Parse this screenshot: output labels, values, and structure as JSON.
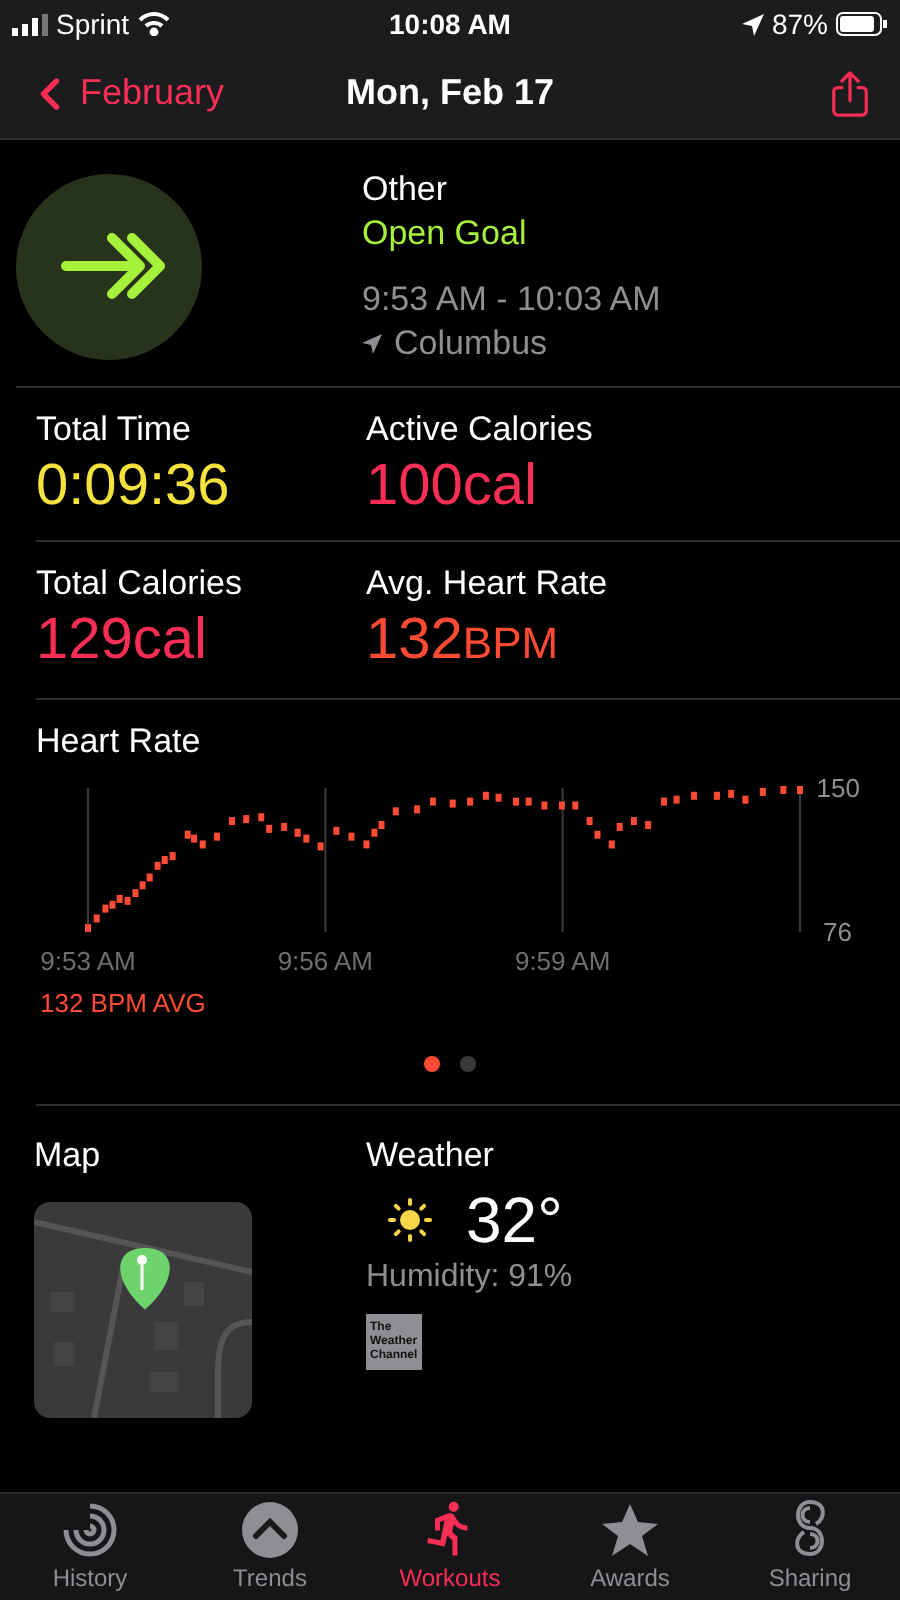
{
  "status_bar": {
    "carrier": "Sprint",
    "time": "10:08 AM",
    "battery": "87%"
  },
  "nav": {
    "back": "February",
    "title": "Mon, Feb 17"
  },
  "workout": {
    "type": "Other",
    "goal": "Open Goal",
    "time_range": "9:53 AM - 10:03 AM",
    "location": "Columbus"
  },
  "stats": [
    {
      "label": "Total Time",
      "value": "0:09:36",
      "color": "#f6e23c"
    },
    {
      "label": "Active Calories",
      "value": "100",
      "unit": "cal",
      "color": "#fa2d55"
    },
    {
      "label": "Total Calories",
      "value": "129",
      "unit": "cal",
      "color": "#fa2d55"
    },
    {
      "label": "Avg. Heart Rate",
      "value": "132",
      "unit": "BPM",
      "color": "#ff4b33"
    }
  ],
  "heart_rate": {
    "title": "Heart Rate",
    "average": "132 BPM AVG",
    "chart_data": {
      "type": "scatter",
      "xticks": [
        {
          "value": 593,
          "label": "9:53 AM"
        },
        {
          "value": 596,
          "label": "9:56 AM"
        },
        {
          "value": 599,
          "label": "9:59 AM"
        }
      ],
      "yticks": [
        76,
        150
      ],
      "ylim": [
        76,
        150
      ],
      "xlim": [
        593,
        602
      ],
      "x": [
        593,
        593.11,
        593.22,
        593.31,
        593.4,
        593.5,
        593.6,
        593.69,
        593.78,
        593.88,
        593.97,
        594.07,
        594.26,
        594.34,
        594.45,
        594.63,
        594.82,
        595,
        595.19,
        595.29,
        595.48,
        595.65,
        595.76,
        595.94,
        596.14,
        596.33,
        596.52,
        596.62,
        596.71,
        596.89,
        597.16,
        597.36,
        597.61,
        597.83,
        598.03,
        598.19,
        598.41,
        598.57,
        598.77,
        598.99,
        599.16,
        599.34,
        599.44,
        599.62,
        599.72,
        599.9,
        600.08,
        600.28,
        600.44,
        600.66,
        600.95,
        601.13,
        601.31,
        601.53,
        601.79,
        602
      ],
      "series": [
        {
          "color": "#ff4b33",
          "values": [
            78,
            83,
            88,
            90,
            93,
            92,
            96,
            100,
            104,
            110,
            113,
            115,
            126,
            124,
            121,
            125,
            133,
            134,
            135,
            129,
            130,
            127,
            124,
            120,
            128,
            125,
            121,
            127,
            131,
            138,
            139,
            143,
            142,
            143,
            146,
            145,
            143,
            143,
            141,
            141,
            141,
            133,
            126,
            121,
            130,
            133,
            131,
            143,
            144,
            146,
            146,
            147,
            144,
            148,
            149,
            149
          ]
        }
      ]
    }
  },
  "pages": [
    {
      "selected": true
    },
    {
      "selected": false
    }
  ],
  "map": {
    "title": "Map",
    "kind": "picture"
  },
  "weather": {
    "title": "Weather",
    "temperature": "32°",
    "humidity": "Humidity: 91%",
    "provider": "The Weather Channel"
  },
  "tabs": [
    {
      "label": "History",
      "selected": false
    },
    {
      "label": "Trends",
      "selected": false
    },
    {
      "label": "Workouts",
      "selected": true
    },
    {
      "label": "Awards",
      "selected": false
    },
    {
      "label": "Sharing",
      "selected": false
    }
  ]
}
